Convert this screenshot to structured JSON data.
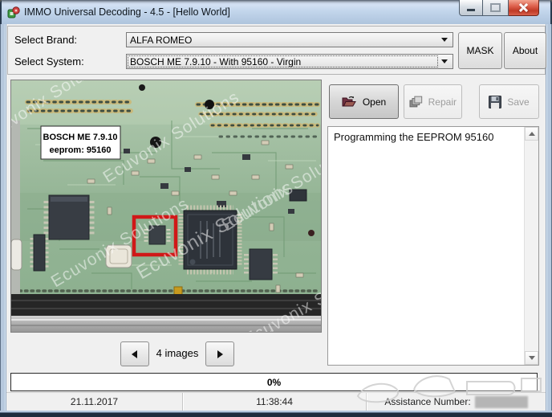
{
  "window": {
    "title": "IMMO Universal Decoding - 4.5 - [Hello World]"
  },
  "icons": {
    "app": "app-icon",
    "minimize": "minimize-icon",
    "maximize": "maximize-icon",
    "close": "close-icon",
    "combo_arrow": "chevron-down-icon",
    "open": "open-folder-icon",
    "repair": "repair-icon",
    "save": "floppy-disk-icon",
    "prev": "arrow-left-icon",
    "next": "arrow-right-icon",
    "scroll_up": "arrow-up-icon",
    "scroll_down": "arrow-down-icon"
  },
  "selectors": {
    "brand_label": "Select Brand:",
    "brand_value": "ALFA ROMEO",
    "system_label": "Select System:",
    "system_value": "BOSCH ME 7.9.10 - With 95160 - Virgin"
  },
  "toolbar": {
    "mask": "MASK",
    "about": "About",
    "open": "Open",
    "repair": "Repair",
    "save": "Save"
  },
  "image_panel": {
    "callout_line1": "BOSCH ME 7.9.10",
    "callout_line2": "eeprom: 95160",
    "watermark": "Ecuvonix Solutions",
    "nav_count": "4 images"
  },
  "log": {
    "text": "Programming the EEPROM 95160"
  },
  "progress": {
    "value": "0%"
  },
  "status_bar": {
    "date": "21.11.2017",
    "time": "11:38:44",
    "assistance_label": "Assistance Number:"
  },
  "colors": {
    "titlebar_blue": "#c3d6ec",
    "close_red": "#c03a26",
    "board_green": "#93b493",
    "highlight_red": "#d01818",
    "background": "#f0f0f0"
  }
}
